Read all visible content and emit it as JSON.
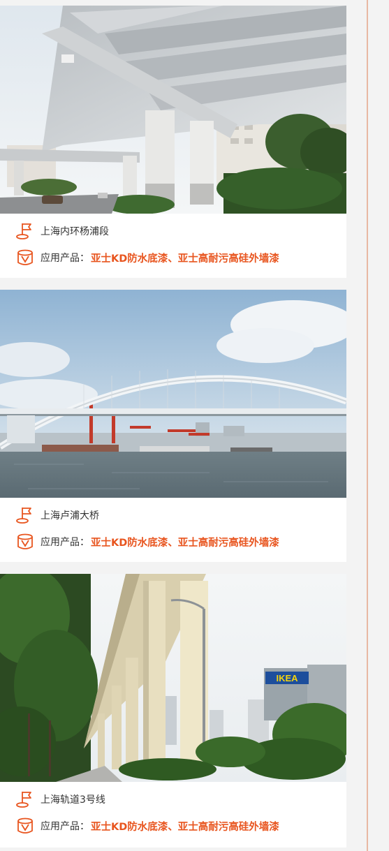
{
  "colors": {
    "accent": "#e8551f",
    "divider": "#e8b8a3",
    "text": "#333333"
  },
  "cards": [
    {
      "photo_alt": "overpass-underside-photo",
      "location": "上海内环杨浦段",
      "product_label": "应用产品：",
      "product_value": "亚士KD防水底漆、亚士高耐污高硅外墙漆",
      "location_icon": "flag-pin-icon",
      "product_icon": "paint-can-icon"
    },
    {
      "photo_alt": "lupu-bridge-photo",
      "location": "上海卢浦大桥",
      "product_label": "应用产品：",
      "product_value": "亚士KD防水底漆、亚士高耐污高硅外墙漆",
      "location_icon": "flag-pin-icon",
      "product_icon": "paint-can-icon"
    },
    {
      "photo_alt": "metro-line3-viaduct-photo",
      "location": "上海轨道3号线",
      "product_label": "应用产品：",
      "product_value": "亚士KD防水底漆、亚士高耐污高硅外墙漆",
      "location_icon": "flag-pin-icon",
      "product_icon": "paint-can-icon"
    }
  ],
  "signage": {
    "ikea": "IKEA"
  }
}
